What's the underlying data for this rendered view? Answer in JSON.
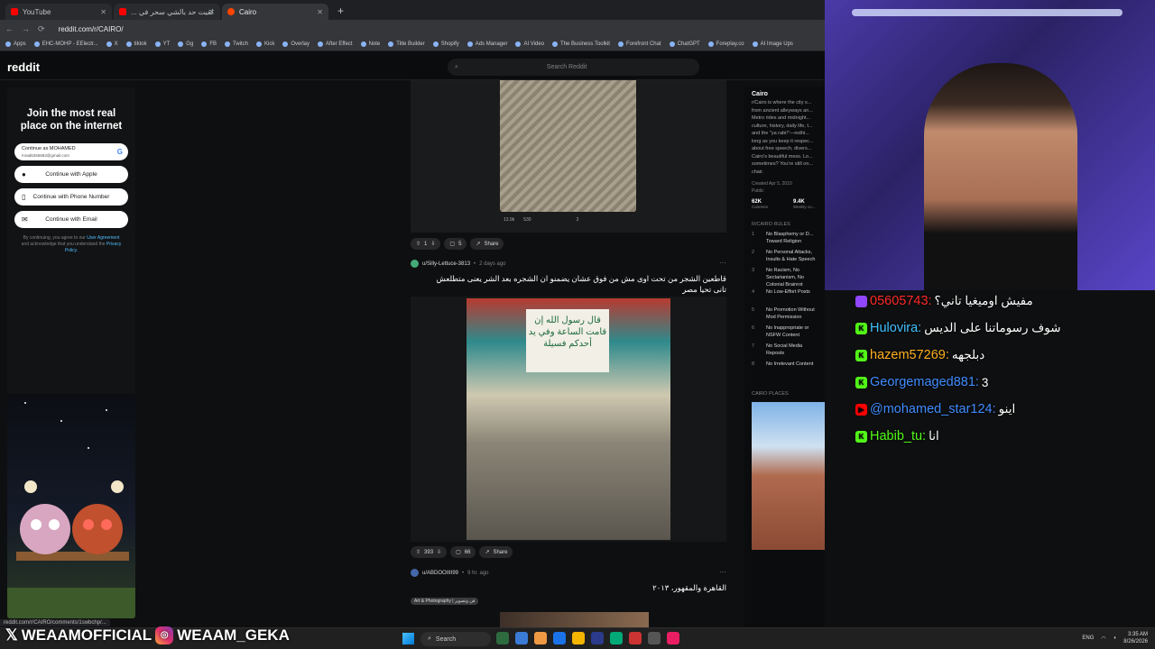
{
  "browser": {
    "tabs": [
      {
        "label": "YouTube",
        "color": "#ff0000"
      },
      {
        "label": "لقيت حد بالشي سحر في ...",
        "color": "#ff0000"
      },
      {
        "label": "Cairo",
        "color": "#ff4500"
      }
    ],
    "new_tab": "+",
    "url": "reddit.com/r/CAIRO/",
    "bookmarks": [
      "Apps",
      "EHC-MOHP - EElectr...",
      "X",
      "tiktok",
      "YT",
      "Gg",
      "FB",
      "Twitch",
      "Kick",
      "Overlay",
      "After Effect",
      "Note",
      "Title Builder",
      "Shopify",
      "Ads Manager",
      "AI Video",
      "The Business Toolkit",
      "Forefront Chat",
      "ChatGPT",
      "Foreplay.co",
      "AI Image Ups"
    ]
  },
  "reddit": {
    "logo": "reddit",
    "search_placeholder": "Search Reddit"
  },
  "signup": {
    "title": "Join the most real place on the internet",
    "google_line1": "Continue as MOHAMED",
    "google_line2": "mrad6265683@gmail.com",
    "apple": "Continue with Apple",
    "phone": "Continue with Phone Number",
    "email": "Continue with Email",
    "legal_pre": "By continuing, you agree to our",
    "legal_ua": "User Agreement",
    "legal_mid": "and acknowledge that you understand the",
    "legal_pp": "Privacy Policy."
  },
  "feed": {
    "post1": {
      "mini_upvotes": "13.9k",
      "mini_comments": "530",
      "mini_shares": "2",
      "votes": "1",
      "comments": "5",
      "share": "Share"
    },
    "post2": {
      "author": "u/Silly-Lettuce-3813",
      "age": "2 days ago",
      "title": "قاطعين الشجر من تحت اوى مش من فوق عشان يضمنو ان الشجره بعد الشر يعنى متطلعش تانى تحيا مصر",
      "wall_text": "قال رسول الله إن قامت الساعة وفي يد أحدكم فسيلة",
      "votes": "393",
      "comments": "66",
      "share": "Share"
    },
    "post3": {
      "author": "u/ABDOOIIII99",
      "age": "9 hr. ago",
      "title": "القاهرة والمقهور، ٢٠١٣",
      "flair": "Art & Photography | فن وتصوير"
    }
  },
  "sidebar": {
    "name": "Cairo",
    "description": "r/Cairo is where the city s... from ancient alleyways an... Metro rides and midnight... culture, history, daily life, t... and the \"ya rabi!\"—nothi... long as you keep it respec... about free speech, divers... Cairo's beautiful mess. Lo... sometimes? You're still on... chair.",
    "created": "Created Apr 5, 2010",
    "visibility": "Public",
    "members": "62K",
    "members_label": "Cairenes",
    "online": "9.4K",
    "online_label": "Weekly co...",
    "rules_header": "R/CAIRO RULES",
    "rules": [
      {
        "n": "1",
        "text": "No Blasphemy or D... Toward Religion"
      },
      {
        "n": "2",
        "text": "No Personal Attacks, Insults & Hate Speech"
      },
      {
        "n": "3",
        "text": "No Racism, No Sectarianism, No Colonial Brainrot"
      },
      {
        "n": "4",
        "text": "No Low-Effort Posts"
      },
      {
        "n": "5",
        "text": "No Promotion Without Mod Permission"
      },
      {
        "n": "6",
        "text": "No Inappropriate or NSFW Content"
      },
      {
        "n": "7",
        "text": "No Social Media Reposts"
      },
      {
        "n": "8",
        "text": "No Irrelevant Content"
      }
    ],
    "places_header": "CAIRO PLACES"
  },
  "chat": [
    {
      "user": "05605743:",
      "msg": "مفيش اوميغيا تاني؟",
      "user_color": "#ff2a2a",
      "badge_color": "#9146ff",
      "badge": ""
    },
    {
      "user": "Hulovira:",
      "msg": "شوف رسوماتنا على الديس",
      "user_color": "#3fc1ff",
      "badge_color": "#53fc18",
      "badge": "K"
    },
    {
      "user": "hazem57269:",
      "msg": "دبلجهه",
      "user_color": "#ffb020",
      "badge_color": "#53fc18",
      "badge": "K"
    },
    {
      "user": "Georgemaged881:",
      "msg": "3",
      "user_color": "#3f8cff",
      "badge_color": "#53fc18",
      "badge": "K"
    },
    {
      "user": "@mohamed_star124:",
      "msg": "اينو",
      "user_color": "#3f8cff",
      "badge_color": "#ff0000",
      "badge": "▶"
    },
    {
      "user": "Habib_tu:",
      "msg": "انا",
      "user_color": "#53fc18",
      "badge_color": "#53fc18",
      "badge": "K"
    }
  ],
  "social": {
    "x_handle": "WEAAMOFFICIAL",
    "ig_handle": "WEAAM_GEKA"
  },
  "status_url": "reddit.com/r/CAIRO/comments/1swbchp/...",
  "taskbar": {
    "search": "Search",
    "lang": "ENG",
    "time": "3:35 AM",
    "date": "8/26/2026"
  }
}
